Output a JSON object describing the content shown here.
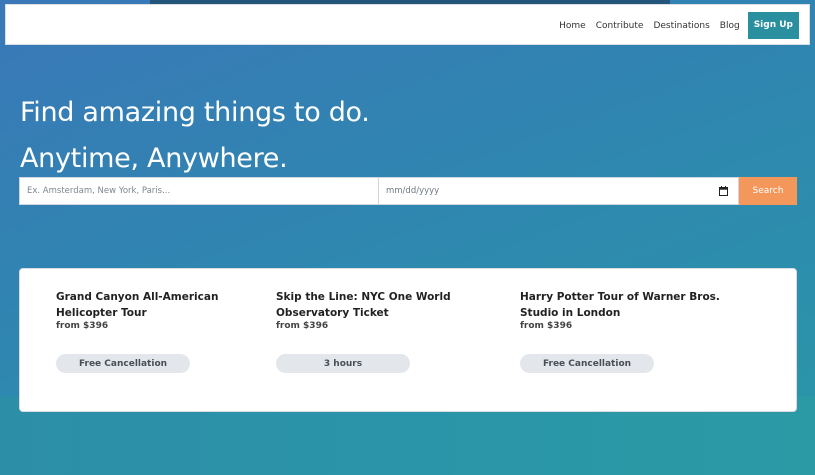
{
  "nav": {
    "items": [
      "Home",
      "Contribute",
      "Destinations",
      "Blog"
    ],
    "signup_label": "Sign Up"
  },
  "hero": {
    "line1": "Find amazing things to do.",
    "line2": "Anytime, Anywhere."
  },
  "search": {
    "location_placeholder": "Ex. Amsterdam, New York, Paris...",
    "date_placeholder": "mm/dd/yyyy",
    "button_label": "Search"
  },
  "tours": [
    {
      "title": "Grand Canyon All-American Helicopter Tour",
      "price": "from $396",
      "badge": "Free Cancellation"
    },
    {
      "title": "Skip the Line: NYC One World Observatory Ticket",
      "price": "from $396",
      "badge": "3 hours"
    },
    {
      "title": "Harry Potter Tour of Warner Bros. Studio in London",
      "price": "from $396",
      "badge": "Free Cancellation"
    }
  ],
  "colors": {
    "accent": "#2a8f9e",
    "search_button": "#f4975b",
    "badge_bg": "#e3e7ec"
  },
  "icons": {
    "date_picker": "calendar-icon"
  }
}
